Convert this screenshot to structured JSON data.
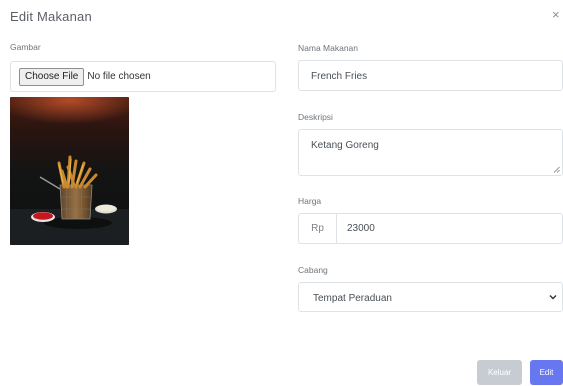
{
  "modal": {
    "title": "Edit Makanan",
    "close_symbol": "×"
  },
  "form": {
    "image_label": "Gambar",
    "file_button_label": "Choose File",
    "file_status": "No file chosen",
    "name_label": "Nama Makanan",
    "name_value": "French Fries",
    "description_label": "Deskripsi",
    "description_value": "Ketang Goreng",
    "price_label": "Harga",
    "price_prefix": "Rp",
    "price_value": "23000",
    "branch_label": "Cabang",
    "branch_selected": "Tempat Peraduan"
  },
  "footer": {
    "close_label": "Keluar",
    "submit_label": "Edit"
  },
  "colors": {
    "close_button": "#c7ccd3",
    "submit_button": "#6777ef",
    "border": "#dfe3e8"
  },
  "icons": {
    "close": "close-icon",
    "select_caret": "chevron-down-icon",
    "resize": "resize-grip-icon"
  }
}
